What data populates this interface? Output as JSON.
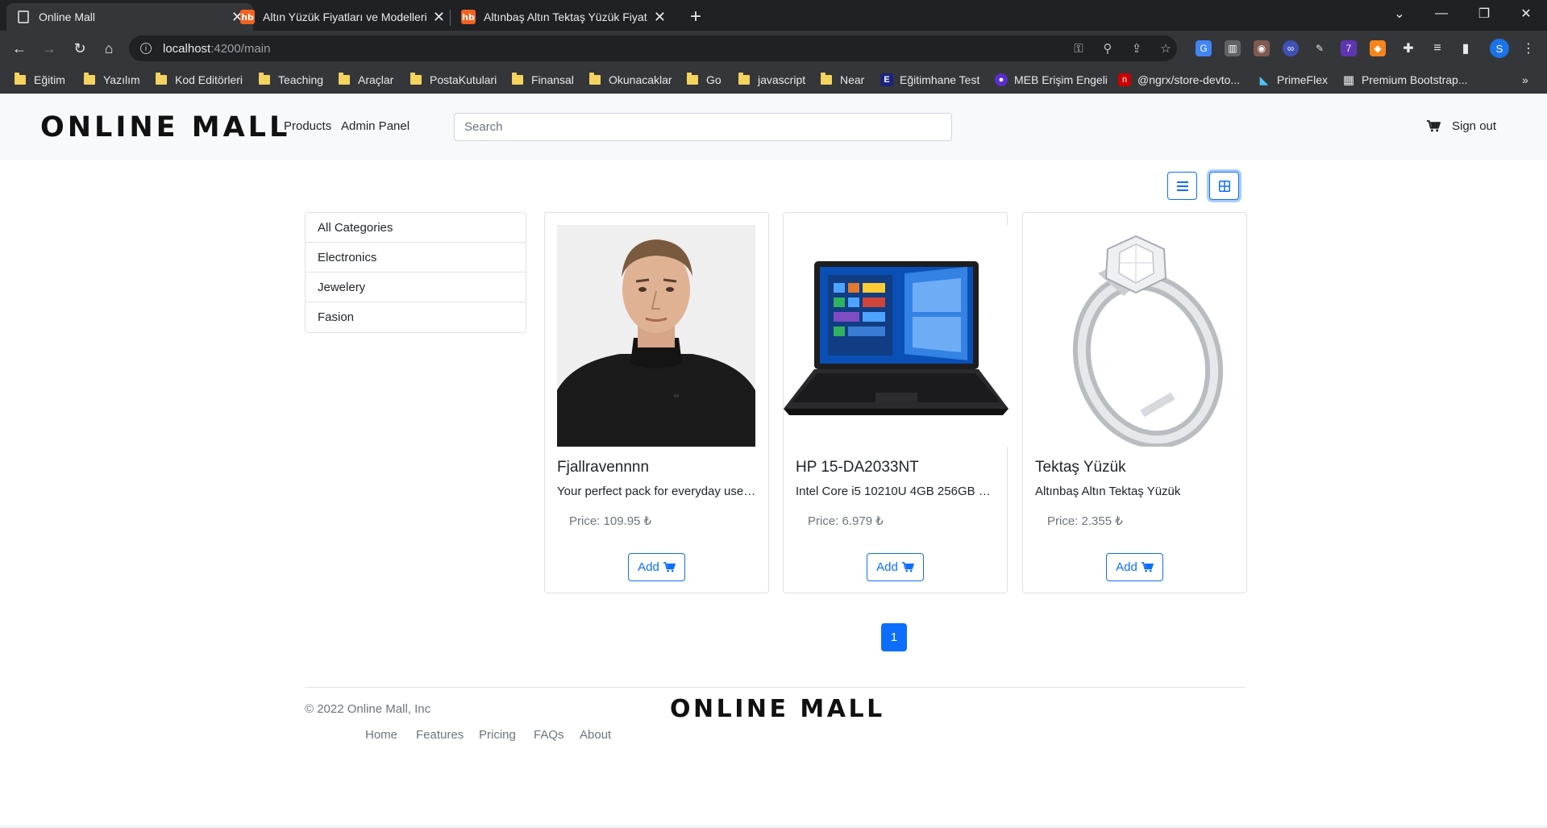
{
  "browser": {
    "tabs": [
      {
        "title": "Online Mall",
        "favicon": "page-icon",
        "active": true
      },
      {
        "title": "Altın Yüzük Fiyatları ve Modelleri",
        "favicon": "hb",
        "active": false
      },
      {
        "title": "Altınbaş Altın Tektaş Yüzük Fiyatı",
        "favicon": "hb",
        "active": false
      }
    ],
    "url_host": "localhost",
    "url_path": ":4200/main",
    "profile_initial": "S",
    "extension_badge": "7",
    "bookmarks": [
      {
        "label": "Eğitim",
        "icon": "folder-icon"
      },
      {
        "label": "Yazılım",
        "icon": "folder-icon"
      },
      {
        "label": "Kod Editörleri",
        "icon": "folder-icon"
      },
      {
        "label": "Teaching",
        "icon": "folder-icon"
      },
      {
        "label": "Araçlar",
        "icon": "folder-icon"
      },
      {
        "label": "PostaKutulari",
        "icon": "folder-icon"
      },
      {
        "label": "Finansal",
        "icon": "folder-icon"
      },
      {
        "label": "Okunacaklar",
        "icon": "folder-icon"
      },
      {
        "label": "Go",
        "icon": "folder-icon"
      },
      {
        "label": "javascript",
        "icon": "folder-icon"
      },
      {
        "label": "Near",
        "icon": "folder-icon"
      },
      {
        "label": "Eğitimhane Test",
        "icon": "site-icon"
      },
      {
        "label": "MEB Erişim Engeli",
        "icon": "site-icon"
      },
      {
        "label": "@ngrx/store-devto...",
        "icon": "site-icon"
      },
      {
        "label": "PrimeFlex",
        "icon": "site-icon"
      },
      {
        "label": "Premium Bootstrap...",
        "icon": "site-icon"
      }
    ],
    "bookmarks_overflow": "»"
  },
  "header": {
    "logo": "ONLINE MALL",
    "nav": [
      "Products",
      "Admin Panel"
    ],
    "search_placeholder": "Search",
    "signout_label": "Sign out"
  },
  "view_toggle": {
    "list_icon": "list-icon",
    "grid_icon": "grid-icon",
    "active": "grid"
  },
  "categories": [
    "All Categories",
    "Electronics",
    "Jewelery",
    "Fasion"
  ],
  "products": [
    {
      "name": "Fjallravennnn",
      "description": "Your perfect pack for everyday use a...",
      "price": "Price: 109.95 ₺",
      "button": "Add",
      "image": "man-in-black-sweater"
    },
    {
      "name": "HP 15-DA2033NT",
      "description": "Intel Core i5 10210U 4GB 256GB SS...",
      "price": "Price: 6.979 ₺",
      "button": "Add",
      "image": "black-laptop"
    },
    {
      "name": "Tektaş Yüzük",
      "description": "Altınbaş Altın Tektaş Yüzük",
      "price": "Price: 2.355 ₺",
      "button": "Add",
      "image": "solitaire-ring"
    }
  ],
  "pagination": {
    "current": "1"
  },
  "footer": {
    "copyright": "© 2022 Online Mall, Inc",
    "logo": "ONLINE MALL",
    "links": [
      "Home",
      "Features",
      "Pricing",
      "FAQs",
      "About"
    ]
  },
  "colors": {
    "primary": "#0d6efd",
    "header_bg": "#f8f9fa",
    "chrome_dark": "#202124",
    "chrome_toolbar": "#35363a"
  }
}
